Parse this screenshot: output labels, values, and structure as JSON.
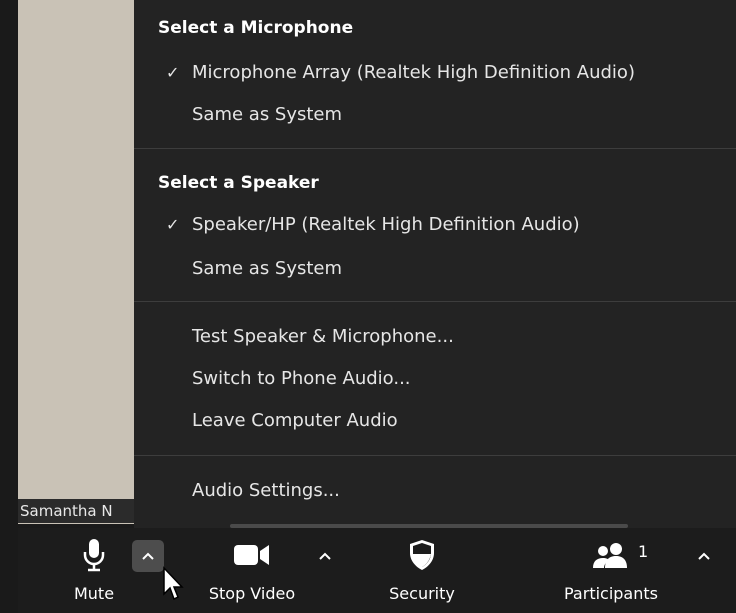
{
  "video": {
    "participant_name": "Samantha N"
  },
  "menu": {
    "microphone_section": {
      "title": "Select a Microphone",
      "items": [
        {
          "label": "Microphone Array (Realtek High Definition Audio)",
          "checked": true
        },
        {
          "label": "Same as System",
          "checked": false
        }
      ]
    },
    "speaker_section": {
      "title": "Select a Speaker",
      "items": [
        {
          "label": "Speaker/HP (Realtek High Definition Audio)",
          "checked": true
        },
        {
          "label": "Same as System",
          "checked": false
        }
      ]
    },
    "actions": [
      {
        "label": "Test Speaker & Microphone..."
      },
      {
        "label": "Switch to Phone Audio..."
      },
      {
        "label": "Leave Computer Audio"
      }
    ],
    "settings": {
      "label": "Audio Settings..."
    },
    "check_glyph": "✓"
  },
  "toolbar": {
    "mute": {
      "label": "Mute",
      "icon": "microphone-icon"
    },
    "video": {
      "label": "Stop Video",
      "icon": "video-camera-icon"
    },
    "security": {
      "label": "Security",
      "icon": "shield-icon"
    },
    "participants": {
      "label": "Participants",
      "icon": "participants-icon",
      "count": "1"
    },
    "caret_glyph": "^"
  },
  "colors": {
    "menu_bg": "#232323",
    "toolbar_bg": "#1c1c1c",
    "text": "#e6e6e6",
    "active_caret_bg": "#4d4d4d",
    "video_bg": "#c9c2b6"
  }
}
